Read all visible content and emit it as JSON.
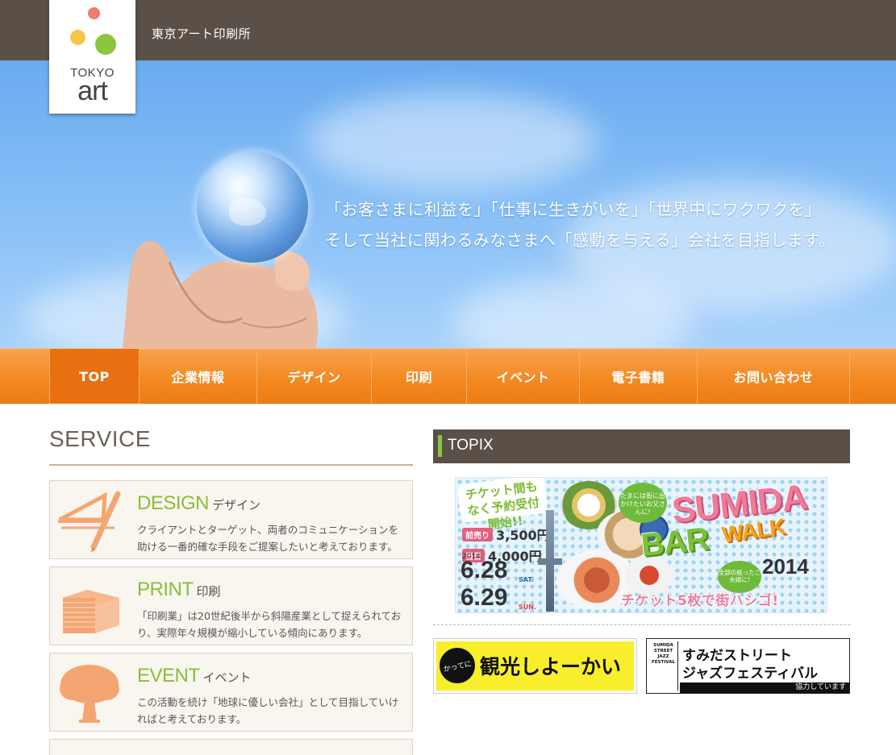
{
  "header": {
    "company_name": "東京アート印刷所",
    "logo": {
      "line1": "TOKYO",
      "line2": "art"
    }
  },
  "hero": {
    "line1": "「お客さまに利益を」「仕事に生きがいを」「世界中にワクワクを」",
    "line2": "そして当社に関わるみなさまへ「感動を与える」会社を目指します。"
  },
  "nav": {
    "items": [
      {
        "label": "TOP"
      },
      {
        "label": "企業情報"
      },
      {
        "label": "デザイン"
      },
      {
        "label": "印刷"
      },
      {
        "label": "イベント"
      },
      {
        "label": "電子書籍"
      },
      {
        "label": "お問い合わせ"
      }
    ]
  },
  "service": {
    "title": "SERVICE",
    "cards": [
      {
        "title": "DESIGN",
        "title_ja": "デザイン",
        "icon": "design-tools-icon",
        "desc": "クライアントとターゲット、両者のコミュニケーションを助ける一番的確な手段をご提案したいと考えております。"
      },
      {
        "title": "PRINT",
        "title_ja": "印刷",
        "icon": "paper-stack-icon",
        "desc": "「印刷業」は20世紀後半から斜陽産業として捉えられており、実際年々規模が縮小している傾向にあります。"
      },
      {
        "title": "EVENT",
        "title_ja": "イベント",
        "icon": "tree-icon",
        "desc": "この活動を続け「地球に優しい会社」として目指していければと考えております。"
      }
    ]
  },
  "topix": {
    "title": "TOPIX",
    "main_banner": {
      "ticket": "チケット間もなく予約受付開始!!",
      "presale_tag": "前売り",
      "presale_price": "3,500円",
      "door_tag": "当日",
      "door_price": "4,000円",
      "year": "2014.",
      "date1": "6.28",
      "day1": "SAT.",
      "date2": "6.29",
      "day2": "SUN.",
      "bubble1": "たまには街に出かけたいお父さんに!",
      "bubble2": "全部の紙ったご夫婦に!",
      "sumida": "SUMIDA",
      "bar": "BAR",
      "walk": "WALK",
      "year_big": "2014",
      "tagline": "チケット5枚で街ハシゴ!"
    },
    "kanko_banner": {
      "badge": "かってに",
      "text": "観光しよーかい"
    },
    "jazz_banner": {
      "side": "SUMIDA STREET JAZZ FESTIVAL",
      "line1": "すみだストリート",
      "line2": "ジャズフェスティバル",
      "footer": "協力しています"
    }
  },
  "colors": {
    "topbar": "#5a5048",
    "nav_orange": "#f38a24",
    "accent_green": "#8cbd3a",
    "logo_red": "#ee7b6b",
    "logo_yellow": "#f5c548",
    "logo_green": "#8cc63f"
  }
}
